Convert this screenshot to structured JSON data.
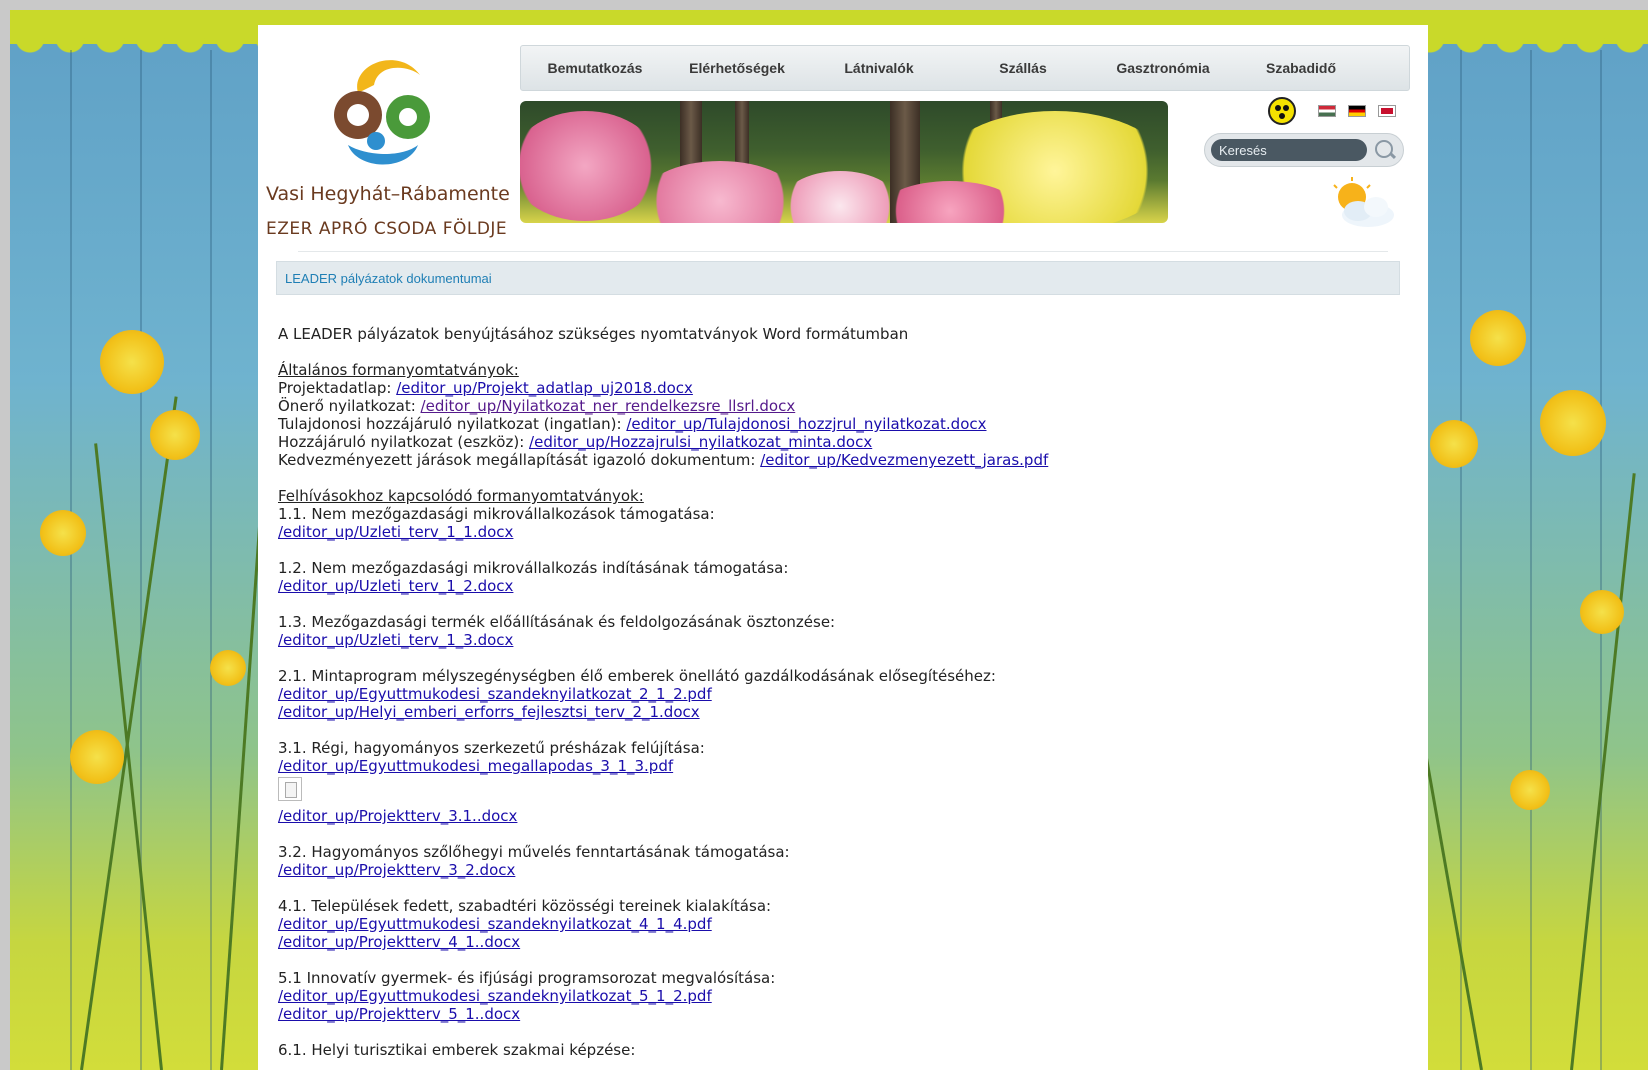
{
  "site": {
    "name": "Vasi Hegyhát–Rábamente",
    "tagline": "EZER APRÓ CSODA FÖLDJE"
  },
  "nav": [
    "Bemutatkozás",
    "Elérhetőségek",
    "Látnivalók",
    "Szállás",
    "Gasztronómia",
    "Szabadidő"
  ],
  "search": {
    "placeholder": "Keresés"
  },
  "heading": "LEADER pályázatok dokumentumai",
  "content": {
    "intro": "A LEADER pályázatok benyújtásához szükséges nyomtatványok Word formátumban",
    "general_title": "Általános formanyomtatványok:",
    "general": [
      {
        "label": "Projektadatlap: ",
        "link": "/editor_up/Projekt_adatlap_uj2018.docx",
        "visited": false
      },
      {
        "label": "Önerő nyilatkozat: ",
        "link": "/editor_up/Nyilatkozat_ner_rendelkezsre_llsrl.docx",
        "visited": true
      },
      {
        "label": "Tulajdonosi hozzájáruló nyilatkozat (ingatlan): ",
        "link": "/editor_up/Tulajdonosi_hozzjrul_nyilatkozat.docx",
        "visited": false
      },
      {
        "label": "Hozzájáruló nyilatkozat (eszköz): ",
        "link": "/editor_up/Hozzajrulsi_nyilatkozat_minta.docx",
        "visited": false
      },
      {
        "label": "Kedvezményezett járások megállapítását igazoló dokumentum: ",
        "link": "/editor_up/Kedvezmenyezett_jaras.pdf",
        "visited": false
      }
    ],
    "calls_title": "Felhívásokhoz kapcsolódó formanyomtatványok:",
    "calls": [
      {
        "title": "1.1. Nem mezőgazdasági mikrovállalkozások támogatása:",
        "links": [
          "/editor_up/Uzleti_terv_1_1.docx"
        ]
      },
      {
        "title": "1.2. Nem mezőgazdasági mikrovállalkozás indításának támogatása:",
        "links": [
          "/editor_up/Uzleti_terv_1_2.docx"
        ]
      },
      {
        "title": "1.3. Mezőgazdasági termék előállításának és feldolgozásának ösztonzése:",
        "links": [
          "/editor_up/Uzleti_terv_1_3.docx"
        ]
      },
      {
        "title": "2.1. Mintaprogram mélyszegénységben élő emberek önellátó gazdálkodásának elősegítéséhez:",
        "links": [
          "/editor_up/Egyuttmukodesi_szandeknyilatkozat_2_1_2.pdf",
          "/editor_up/Helyi_emberi_erforrs_fejlesztsi_terv_2_1.docx"
        ]
      },
      {
        "title": "3.1. Régi, hagyományos szerkezetű présházak felújítása:",
        "links": [
          "/editor_up/Egyuttmukodesi_megallapodas_3_1_3.pdf"
        ],
        "icon": true,
        "links_after": [
          "/editor_up/Projektterv_3.1..docx"
        ]
      },
      {
        "title": "3.2. Hagyományos szőlőhegyi művelés fenntartásának támogatása:",
        "links": [
          "/editor_up/Projektterv_3_2.docx"
        ]
      },
      {
        "title": "4.1. Települések fedett, szabadtéri közösségi tereinek kialakítása:",
        "links": [
          "/editor_up/Egyuttmukodesi_szandeknyilatkozat_4_1_4.pdf",
          "/editor_up/Projektterv_4_1..docx"
        ]
      },
      {
        "title": "5.1 Innovatív gyermek- és ifjúsági programsorozat megvalósítása:",
        "links": [
          "/editor_up/Egyuttmukodesi_szandeknyilatkozat_5_1_2.pdf",
          "/editor_up/Projektterv_5_1..docx"
        ]
      },
      {
        "title": "6.1. Helyi turisztikai emberek szakmai képzése:",
        "links": []
      }
    ]
  },
  "icons": {
    "accessibility": "accessibility-icon",
    "flags": [
      "flag-hu-icon",
      "flag-de-icon",
      "flag-en-icon"
    ],
    "search": "search-icon",
    "weather": "weather-sunny-cloudy-icon",
    "file": "broken-image-icon"
  },
  "colors": {
    "link": "#1a0dab",
    "visited": "#551a8b",
    "heading": "#1f7fb5",
    "accent_green": "#c9d92a"
  }
}
